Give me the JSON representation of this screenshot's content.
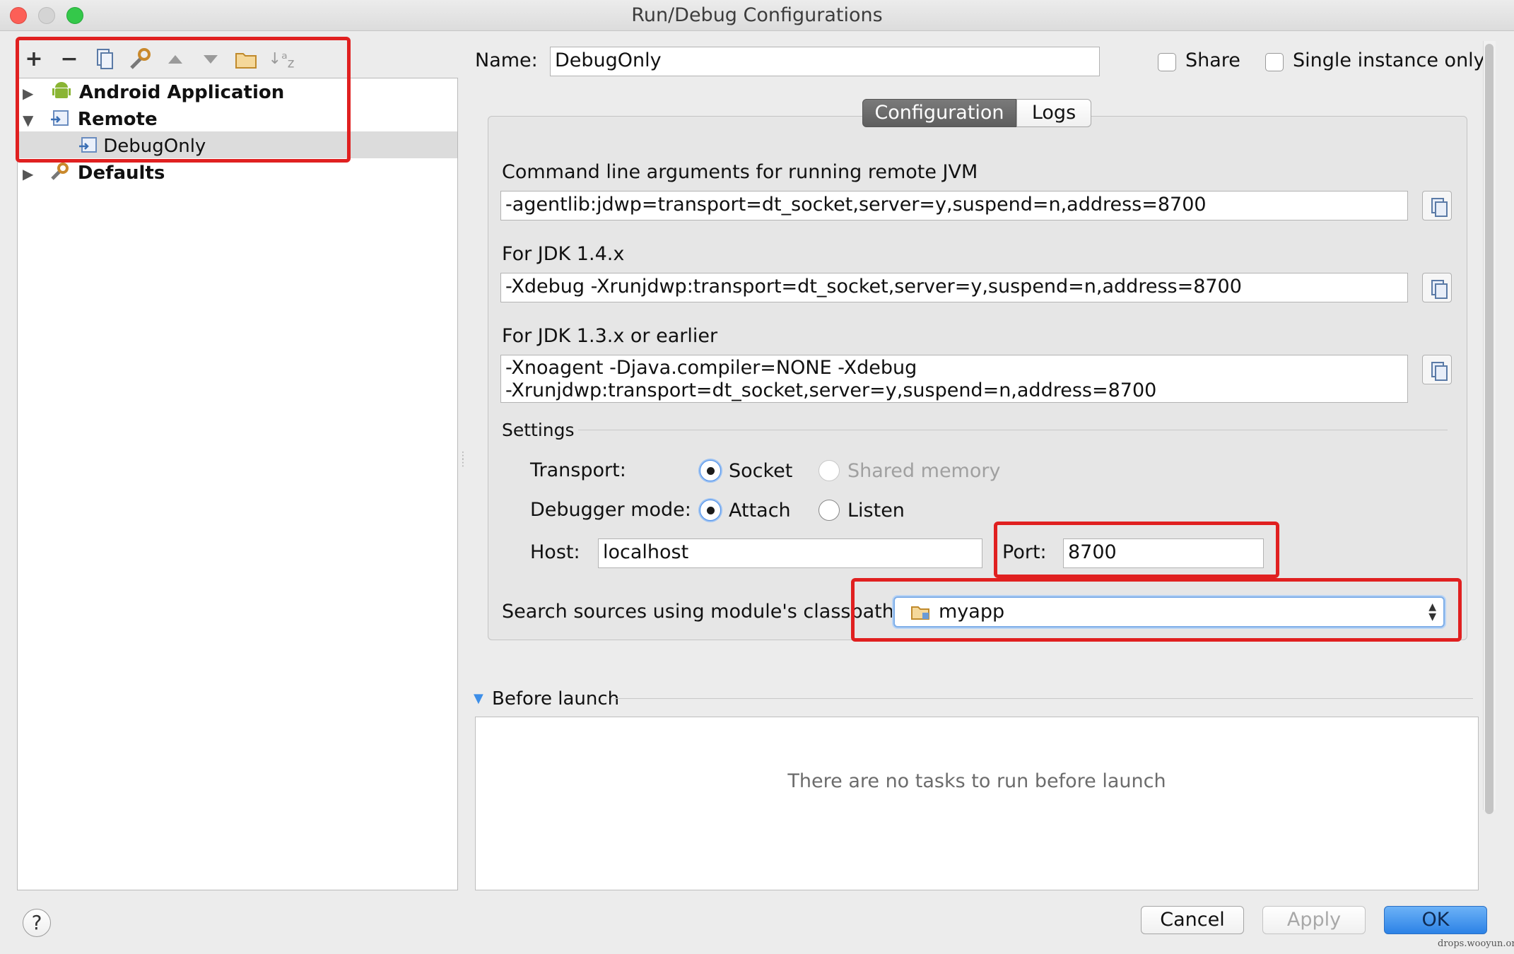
{
  "window": {
    "title": "Run/Debug Configurations"
  },
  "tree": {
    "items": [
      {
        "label": "Android Application",
        "icon": "android-icon"
      },
      {
        "label": "Remote",
        "icon": "remote-config-icon"
      },
      {
        "label": "DebugOnly",
        "icon": "remote-config-icon"
      },
      {
        "label": "Defaults",
        "icon": "wrench-icon"
      }
    ],
    "toolbar": [
      "add-icon",
      "remove-icon",
      "copy-icon",
      "wrench-icon",
      "move-up-icon",
      "move-down-icon",
      "folder-icon",
      "sort-alpha-icon"
    ]
  },
  "config": {
    "name_label": "Name:",
    "name_value": "DebugOnly",
    "share_label": "Share",
    "single_instance_label": "Single instance only",
    "tabs": [
      {
        "label": "Configuration",
        "active": true
      },
      {
        "label": "Logs",
        "active": false
      }
    ],
    "cmd_label": "Command line arguments for running remote JVM",
    "cmd_value": "-agentlib:jdwp=transport=dt_socket,server=y,suspend=n,address=8700",
    "jdk14_label": "For JDK 1.4.x",
    "jdk14_value": "-Xdebug -Xrunjdwp:transport=dt_socket,server=y,suspend=n,address=8700",
    "jdk13_label": "For JDK 1.3.x or earlier",
    "jdk13_line1": "-Xnoagent -Djava.compiler=NONE -Xdebug",
    "jdk13_line2": "-Xrunjdwp:transport=dt_socket,server=y,suspend=n,address=8700",
    "settings_label": "Settings",
    "transport_label": "Transport:",
    "transport_socket": "Socket",
    "transport_shared": "Shared memory",
    "mode_label": "Debugger mode:",
    "mode_attach": "Attach",
    "mode_listen": "Listen",
    "host_label": "Host:",
    "host_value": "localhost",
    "port_label": "Port:",
    "port_value": "8700",
    "classpath_label": "Search sources using module's classpath:",
    "classpath_value": "myapp"
  },
  "before_launch": {
    "label": "Before launch",
    "empty_text": "There are no tasks to run before launch"
  },
  "buttons": {
    "help": "?",
    "cancel": "Cancel",
    "apply": "Apply",
    "ok": "OK"
  },
  "watermark": "drops.wooyun.org",
  "colors": {
    "accent": "#3d8ee8",
    "highlight": "#e02020",
    "selection": "#dcdcdc"
  }
}
